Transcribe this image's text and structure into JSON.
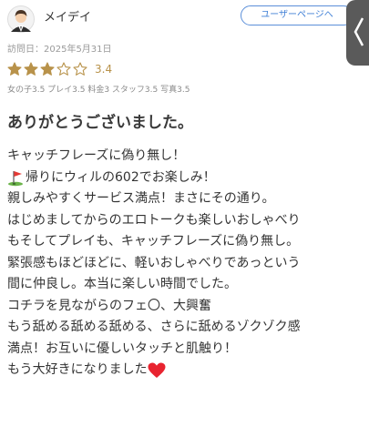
{
  "user": {
    "name": "メイデイ",
    "avatar_icon": "user-avatar-icon"
  },
  "header": {
    "user_page_button": "ユーザーページへ"
  },
  "review": {
    "visit_date": "訪問日：2025年5月31日",
    "rating": 3.4,
    "rating_text": "3.4",
    "stars_max": 5,
    "sub_ratings": "女の子3.5 プレイ3.5 料金3 スタッフ3.5 写真3.5",
    "title": "ありがとうございました。",
    "lines": [
      "キャッチフレーズに偽り無し！",
      "帰りにウィルの602でお楽しみ！",
      "親しみやすくサービス満点！まさにその通り。",
      "はじめましてからのエロトークも楽しいおしゃべり",
      "もそしてプレイも、キャッチフレーズに偽り無し。",
      "緊張感もほどほどに、軽いおしゃべりであっという",
      "間に仲良し。本当に楽しい時間でした。",
      "コチラを見ながらのフェ〇、大興奮",
      "もう舐める舐める舐める、さらに舐めるゾクゾク感",
      "満点！お互いに優しいタッチと肌触り！",
      "もう大好きになりました"
    ]
  },
  "colors": {
    "accent_blue": "#3f7fd6",
    "star_gold": "#b8924a",
    "side_tab": "#5a5a5a"
  }
}
